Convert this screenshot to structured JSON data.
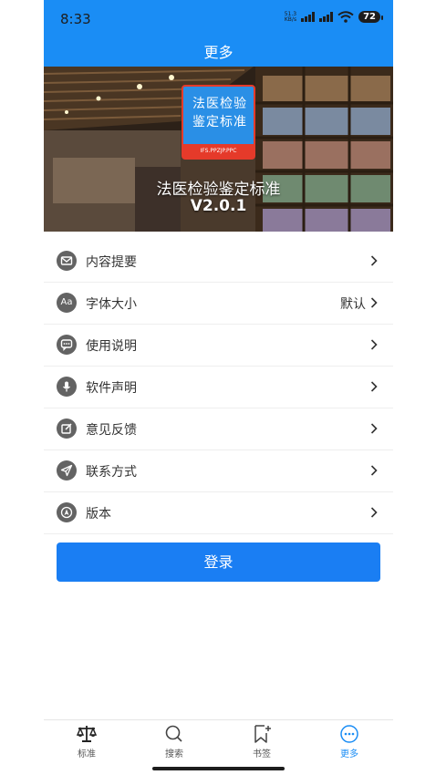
{
  "status": {
    "time": "8:33",
    "net_speed_top": "51.3",
    "net_speed_bottom": "KB/s",
    "battery": "72"
  },
  "header": {
    "title": "更多"
  },
  "banner": {
    "badge_line1": "法医检验",
    "badge_line2": "鉴定标准",
    "badge_strip": "IFS.PPZJP.PPC",
    "app_name": "法医检验鉴定标准",
    "version": "V2.0.1"
  },
  "menu": {
    "items": [
      {
        "label": "内容提要",
        "icon": "mail-icon"
      },
      {
        "label": "字体大小",
        "icon": "font-size-icon",
        "value": "默认",
        "icon_text": "Aa"
      },
      {
        "label": "使用说明",
        "icon": "chat-icon"
      },
      {
        "label": "软件声明",
        "icon": "microphone-icon"
      },
      {
        "label": "意见反馈",
        "icon": "edit-icon"
      },
      {
        "label": "联系方式",
        "icon": "send-icon"
      },
      {
        "label": "版本",
        "icon": "compass-icon"
      }
    ]
  },
  "login": {
    "label": "登录"
  },
  "tabbar": {
    "tabs": [
      {
        "label": "标准",
        "icon": "scales-icon"
      },
      {
        "label": "搜索",
        "icon": "search-icon"
      },
      {
        "label": "书签",
        "icon": "bookmark-icon"
      },
      {
        "label": "更多",
        "icon": "more-icon",
        "active": true
      }
    ]
  },
  "colors": {
    "primary": "#1a8df5",
    "button": "#1a7ef3",
    "icon_bg": "#636363",
    "badge_red": "#e53a2a"
  }
}
